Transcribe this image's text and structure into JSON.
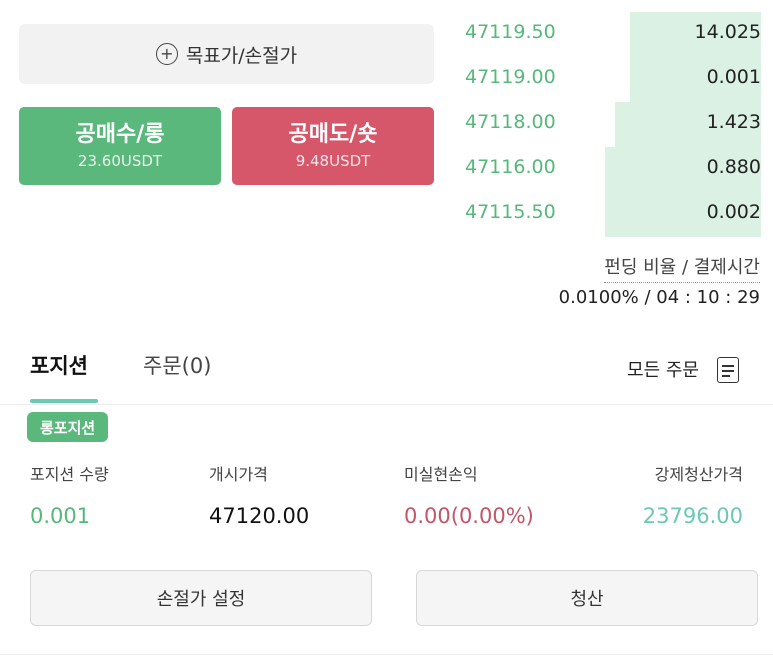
{
  "tpsl": {
    "label": "목표가/손절가"
  },
  "trade": {
    "long": {
      "label": "공매수/롱",
      "amount": "23.60USDT",
      "color": "#5bb87c"
    },
    "short": {
      "label": "공매도/숏",
      "amount": "9.48USDT",
      "color": "#d6566a"
    }
  },
  "orderbook": {
    "bids": [
      {
        "price": "47119.50",
        "qty": "14.025",
        "depth_pct": 43
      },
      {
        "price": "47119.00",
        "qty": "0.001",
        "depth_pct": 43
      },
      {
        "price": "47118.00",
        "qty": "1.423",
        "depth_pct": 48
      },
      {
        "price": "47116.00",
        "qty": "0.880",
        "depth_pct": 51
      },
      {
        "price": "47115.50",
        "qty": "0.002",
        "depth_pct": 51
      }
    ]
  },
  "funding": {
    "label": "펀딩 비율 / 결제시간",
    "value": "0.0100% / 04 : 10 : 29"
  },
  "tabs": {
    "positions": "포지션",
    "orders": "주문(0)",
    "all_orders": "모든 주문"
  },
  "position": {
    "badge": "롱포지션",
    "columns": [
      {
        "label": "포지션 수량",
        "value": "0.001",
        "color": "#56b87a"
      },
      {
        "label": "개시가격",
        "value": "47120.00",
        "color": "#111111"
      },
      {
        "label": "미실현손익",
        "value": "0.00(0.00%)",
        "color": "#c2566a"
      },
      {
        "label": "강제청산가격",
        "value": "23796.00",
        "color": "#6cc8b3"
      }
    ],
    "buttons": {
      "stop_loss": "손절가 설정",
      "close": "청산"
    }
  }
}
